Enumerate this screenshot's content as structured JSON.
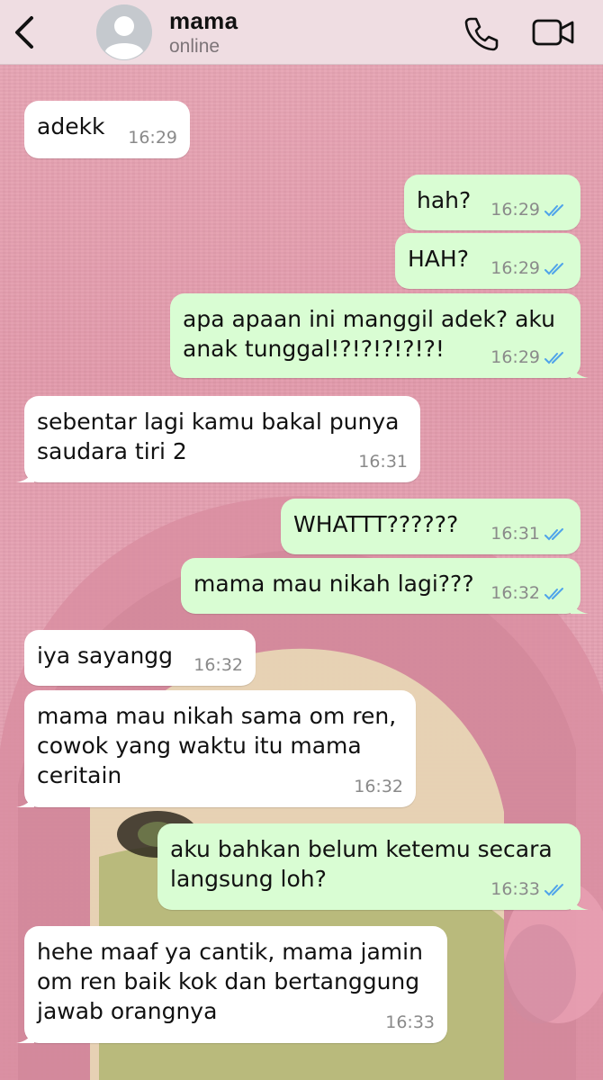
{
  "header": {
    "contact_name": "mama",
    "status": "online",
    "back_icon": "chevron-left-icon",
    "call_icon": "phone-icon",
    "video_icon": "video-camera-icon"
  },
  "colors": {
    "header_bg": "#efdde2",
    "incoming_bubble": "#ffffff",
    "outgoing_bubble": "#d9fdd3",
    "read_ticks": "#4fa3ea",
    "wallpaper": "#e29aab"
  },
  "messages": [
    {
      "direction": "in",
      "text": "adekk",
      "time": "16:29"
    },
    {
      "direction": "out",
      "text": "hah?",
      "time": "16:29",
      "read": true
    },
    {
      "direction": "out",
      "text": "HAH?",
      "time": "16:29",
      "read": true
    },
    {
      "direction": "out",
      "text": "apa apaan ini manggil adek? aku\nanak tunggal!?!?!?!?!?!",
      "time": "16:29",
      "read": true
    },
    {
      "direction": "in",
      "text": "sebentar lagi kamu bakal punya\nsaudara tiri 2",
      "time": "16:31"
    },
    {
      "direction": "out",
      "text": "WHATTT??????",
      "time": "16:31",
      "read": true
    },
    {
      "direction": "out",
      "text": "mama mau nikah lagi???",
      "time": "16:32",
      "read": true
    },
    {
      "direction": "in",
      "text": "iya sayangg",
      "time": "16:32"
    },
    {
      "direction": "in",
      "text": "mama mau nikah sama om ren,\ncowok yang waktu itu mama\nceritain",
      "time": "16:32"
    },
    {
      "direction": "out",
      "text": "aku bahkan belum ketemu secara\nlangsung loh?",
      "time": "16:33",
      "read": true
    },
    {
      "direction": "in",
      "text": "hehe maaf ya cantik, mama jamin\nom ren baik kok dan bertanggung\njawab orangnya",
      "time": "16:33"
    }
  ]
}
